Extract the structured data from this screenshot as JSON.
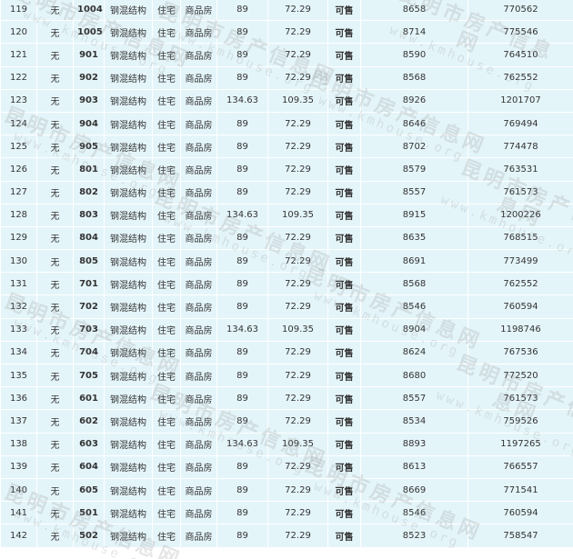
{
  "listing": {
    "rows": [
      {
        "no": "119",
        "balcony": "无",
        "room": "1004",
        "structure": "钢混结构",
        "use": "住宅",
        "type": "商品房",
        "area": "89",
        "inner_area": "72.29",
        "status": "可售",
        "unit_price": "8658",
        "total": "770562"
      },
      {
        "no": "120",
        "balcony": "无",
        "room": "1005",
        "structure": "钢混结构",
        "use": "住宅",
        "type": "商品房",
        "area": "89",
        "inner_area": "72.29",
        "status": "可售",
        "unit_price": "8714",
        "total": "775546"
      },
      {
        "no": "121",
        "balcony": "无",
        "room": "901",
        "structure": "钢混结构",
        "use": "住宅",
        "type": "商品房",
        "area": "89",
        "inner_area": "72.29",
        "status": "可售",
        "unit_price": "8590",
        "total": "764510"
      },
      {
        "no": "122",
        "balcony": "无",
        "room": "902",
        "structure": "钢混结构",
        "use": "住宅",
        "type": "商品房",
        "area": "89",
        "inner_area": "72.29",
        "status": "可售",
        "unit_price": "8568",
        "total": "762552"
      },
      {
        "no": "123",
        "balcony": "无",
        "room": "903",
        "structure": "钢混结构",
        "use": "住宅",
        "type": "商品房",
        "area": "134.63",
        "inner_area": "109.35",
        "status": "可售",
        "unit_price": "8926",
        "total": "1201707"
      },
      {
        "no": "124",
        "balcony": "无",
        "room": "904",
        "structure": "钢混结构",
        "use": "住宅",
        "type": "商品房",
        "area": "89",
        "inner_area": "72.29",
        "status": "可售",
        "unit_price": "8646",
        "total": "769494"
      },
      {
        "no": "125",
        "balcony": "无",
        "room": "905",
        "structure": "钢混结构",
        "use": "住宅",
        "type": "商品房",
        "area": "89",
        "inner_area": "72.29",
        "status": "可售",
        "unit_price": "8702",
        "total": "774478"
      },
      {
        "no": "126",
        "balcony": "无",
        "room": "801",
        "structure": "钢混结构",
        "use": "住宅",
        "type": "商品房",
        "area": "89",
        "inner_area": "72.29",
        "status": "可售",
        "unit_price": "8579",
        "total": "763531"
      },
      {
        "no": "127",
        "balcony": "无",
        "room": "802",
        "structure": "钢混结构",
        "use": "住宅",
        "type": "商品房",
        "area": "89",
        "inner_area": "72.29",
        "status": "可售",
        "unit_price": "8557",
        "total": "761573"
      },
      {
        "no": "128",
        "balcony": "无",
        "room": "803",
        "structure": "钢混结构",
        "use": "住宅",
        "type": "商品房",
        "area": "134.63",
        "inner_area": "109.35",
        "status": "可售",
        "unit_price": "8915",
        "total": "1200226"
      },
      {
        "no": "129",
        "balcony": "无",
        "room": "804",
        "structure": "钢混结构",
        "use": "住宅",
        "type": "商品房",
        "area": "89",
        "inner_area": "72.29",
        "status": "可售",
        "unit_price": "8635",
        "total": "768515"
      },
      {
        "no": "130",
        "balcony": "无",
        "room": "805",
        "structure": "钢混结构",
        "use": "住宅",
        "type": "商品房",
        "area": "89",
        "inner_area": "72.29",
        "status": "可售",
        "unit_price": "8691",
        "total": "773499"
      },
      {
        "no": "131",
        "balcony": "无",
        "room": "701",
        "structure": "钢混结构",
        "use": "住宅",
        "type": "商品房",
        "area": "89",
        "inner_area": "72.29",
        "status": "可售",
        "unit_price": "8568",
        "total": "762552"
      },
      {
        "no": "132",
        "balcony": "无",
        "room": "702",
        "structure": "钢混结构",
        "use": "住宅",
        "type": "商品房",
        "area": "89",
        "inner_area": "72.29",
        "status": "可售",
        "unit_price": "8546",
        "total": "760594"
      },
      {
        "no": "133",
        "balcony": "无",
        "room": "703",
        "structure": "钢混结构",
        "use": "住宅",
        "type": "商品房",
        "area": "134.63",
        "inner_area": "109.35",
        "status": "可售",
        "unit_price": "8904",
        "total": "1198746"
      },
      {
        "no": "134",
        "balcony": "无",
        "room": "704",
        "structure": "钢混结构",
        "use": "住宅",
        "type": "商品房",
        "area": "89",
        "inner_area": "72.29",
        "status": "可售",
        "unit_price": "8624",
        "total": "767536"
      },
      {
        "no": "135",
        "balcony": "无",
        "room": "705",
        "structure": "钢混结构",
        "use": "住宅",
        "type": "商品房",
        "area": "89",
        "inner_area": "72.29",
        "status": "可售",
        "unit_price": "8680",
        "total": "772520"
      },
      {
        "no": "136",
        "balcony": "无",
        "room": "601",
        "structure": "钢混结构",
        "use": "住宅",
        "type": "商品房",
        "area": "89",
        "inner_area": "72.29",
        "status": "可售",
        "unit_price": "8557",
        "total": "761573"
      },
      {
        "no": "137",
        "balcony": "无",
        "room": "602",
        "structure": "钢混结构",
        "use": "住宅",
        "type": "商品房",
        "area": "89",
        "inner_area": "72.29",
        "status": "可售",
        "unit_price": "8534",
        "total": "759526"
      },
      {
        "no": "138",
        "balcony": "无",
        "room": "603",
        "structure": "钢混结构",
        "use": "住宅",
        "type": "商品房",
        "area": "134.63",
        "inner_area": "109.35",
        "status": "可售",
        "unit_price": "8893",
        "total": "1197265"
      },
      {
        "no": "139",
        "balcony": "无",
        "room": "604",
        "structure": "钢混结构",
        "use": "住宅",
        "type": "商品房",
        "area": "89",
        "inner_area": "72.29",
        "status": "可售",
        "unit_price": "8613",
        "total": "766557"
      },
      {
        "no": "140",
        "balcony": "无",
        "room": "605",
        "structure": "钢混结构",
        "use": "住宅",
        "type": "商品房",
        "area": "89",
        "inner_area": "72.29",
        "status": "可售",
        "unit_price": "8669",
        "total": "771541"
      },
      {
        "no": "141",
        "balcony": "无",
        "room": "501",
        "structure": "钢混结构",
        "use": "住宅",
        "type": "商品房",
        "area": "89",
        "inner_area": "72.29",
        "status": "可售",
        "unit_price": "8546",
        "total": "760594"
      },
      {
        "no": "142",
        "balcony": "无",
        "room": "502",
        "structure": "钢混结构",
        "use": "住宅",
        "type": "商品房",
        "area": "89",
        "inner_area": "72.29",
        "status": "可售",
        "unit_price": "8523",
        "total": "758547"
      }
    ]
  },
  "watermark": {
    "text_cn": "昆明市房产信息网",
    "text_en": "www.kmhouse.org"
  },
  "colors": {
    "row_background": "#e4f5fa",
    "room_link": "#1a2a8c",
    "status_available": "#1a7a1a"
  }
}
